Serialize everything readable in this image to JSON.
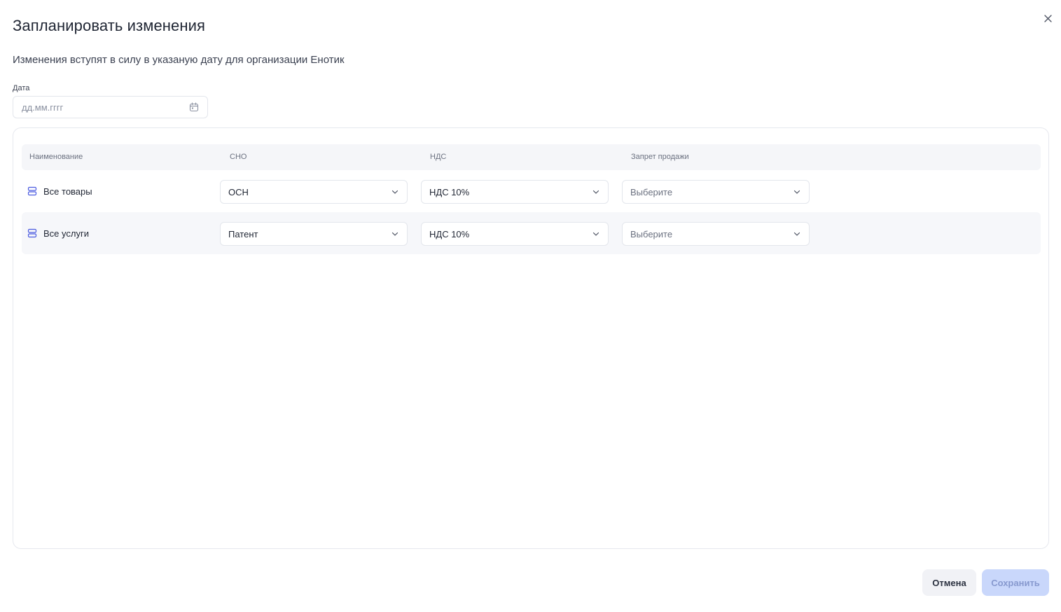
{
  "dialog": {
    "title": "Запланировать изменения",
    "subtitle": "Изменения вступят в силу в указаную дату для организации Енотик",
    "close_icon": "close-icon"
  },
  "date": {
    "label": "Дата",
    "placeholder": "дд.мм.гггг",
    "value": "",
    "icon": "calendar-icon"
  },
  "table": {
    "headers": {
      "name": "Наименование",
      "sno": "СНО",
      "nds": "НДС",
      "sale_ban": "Запрет продажи"
    },
    "rows": [
      {
        "name": "Все товары",
        "icon": "database-icon",
        "sno": "ОСН",
        "nds": "НДС 10%",
        "sale_ban": "Выберите"
      },
      {
        "name": "Все услуги",
        "icon": "database-icon",
        "sno": "Патент",
        "nds": "НДС 10%",
        "sale_ban": "Выберите"
      }
    ]
  },
  "footer": {
    "cancel_label": "Отмена",
    "save_label": "Сохранить"
  },
  "colors": {
    "accent": "#4a5ae0",
    "save_disabled_bg": "#c9d7fb",
    "save_disabled_text": "#8799cf"
  }
}
